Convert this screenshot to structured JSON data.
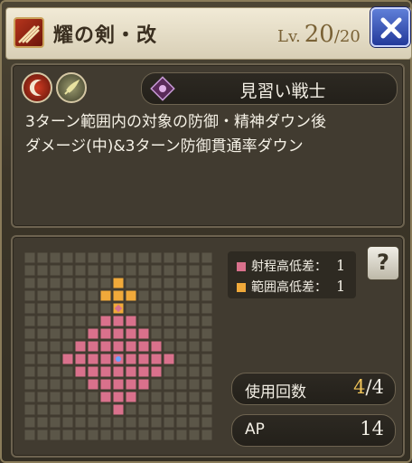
{
  "header": {
    "skill_name": "耀の剣・改",
    "level_label": "Lv.",
    "level_current": "20",
    "level_separator": "/",
    "level_max": "20"
  },
  "description": {
    "element_icons": [
      "red-crescent-slash-icon",
      "feather-wind-icon"
    ],
    "job_icon": "purple-crest-icon",
    "job_name": "見習い戦士",
    "text": "3ターン範囲内の対象の防御・精神ダウン後\nダメージ(中)&3ターン防御貫通率ダウン"
  },
  "range": {
    "legend": [
      {
        "label": "射程高低差：",
        "value": "1",
        "color": "#d9718c"
      },
      {
        "label": "範囲高低差：",
        "value": "1",
        "color": "#f0a93a"
      }
    ],
    "help_label": "?",
    "use_count_label": "使用回数",
    "use_count_current": "4",
    "use_count_separator": "/",
    "use_count_max": "4",
    "ap_label": "AP",
    "ap_value": "14",
    "grid": {
      "cols": 15,
      "rows": 15,
      "center": [
        7,
        7
      ],
      "area_cells": [
        [
          7,
          2
        ],
        [
          6,
          3
        ],
        [
          7,
          3
        ],
        [
          8,
          3
        ]
      ],
      "target_cell": [
        7,
        4
      ],
      "range_radius": 4,
      "range_offset": [
        0,
        7
      ]
    },
    "colors": {
      "grid": "#5b5648",
      "range": "#d9718c",
      "area": "#f0a93a",
      "center": "#6aa2ff"
    }
  }
}
